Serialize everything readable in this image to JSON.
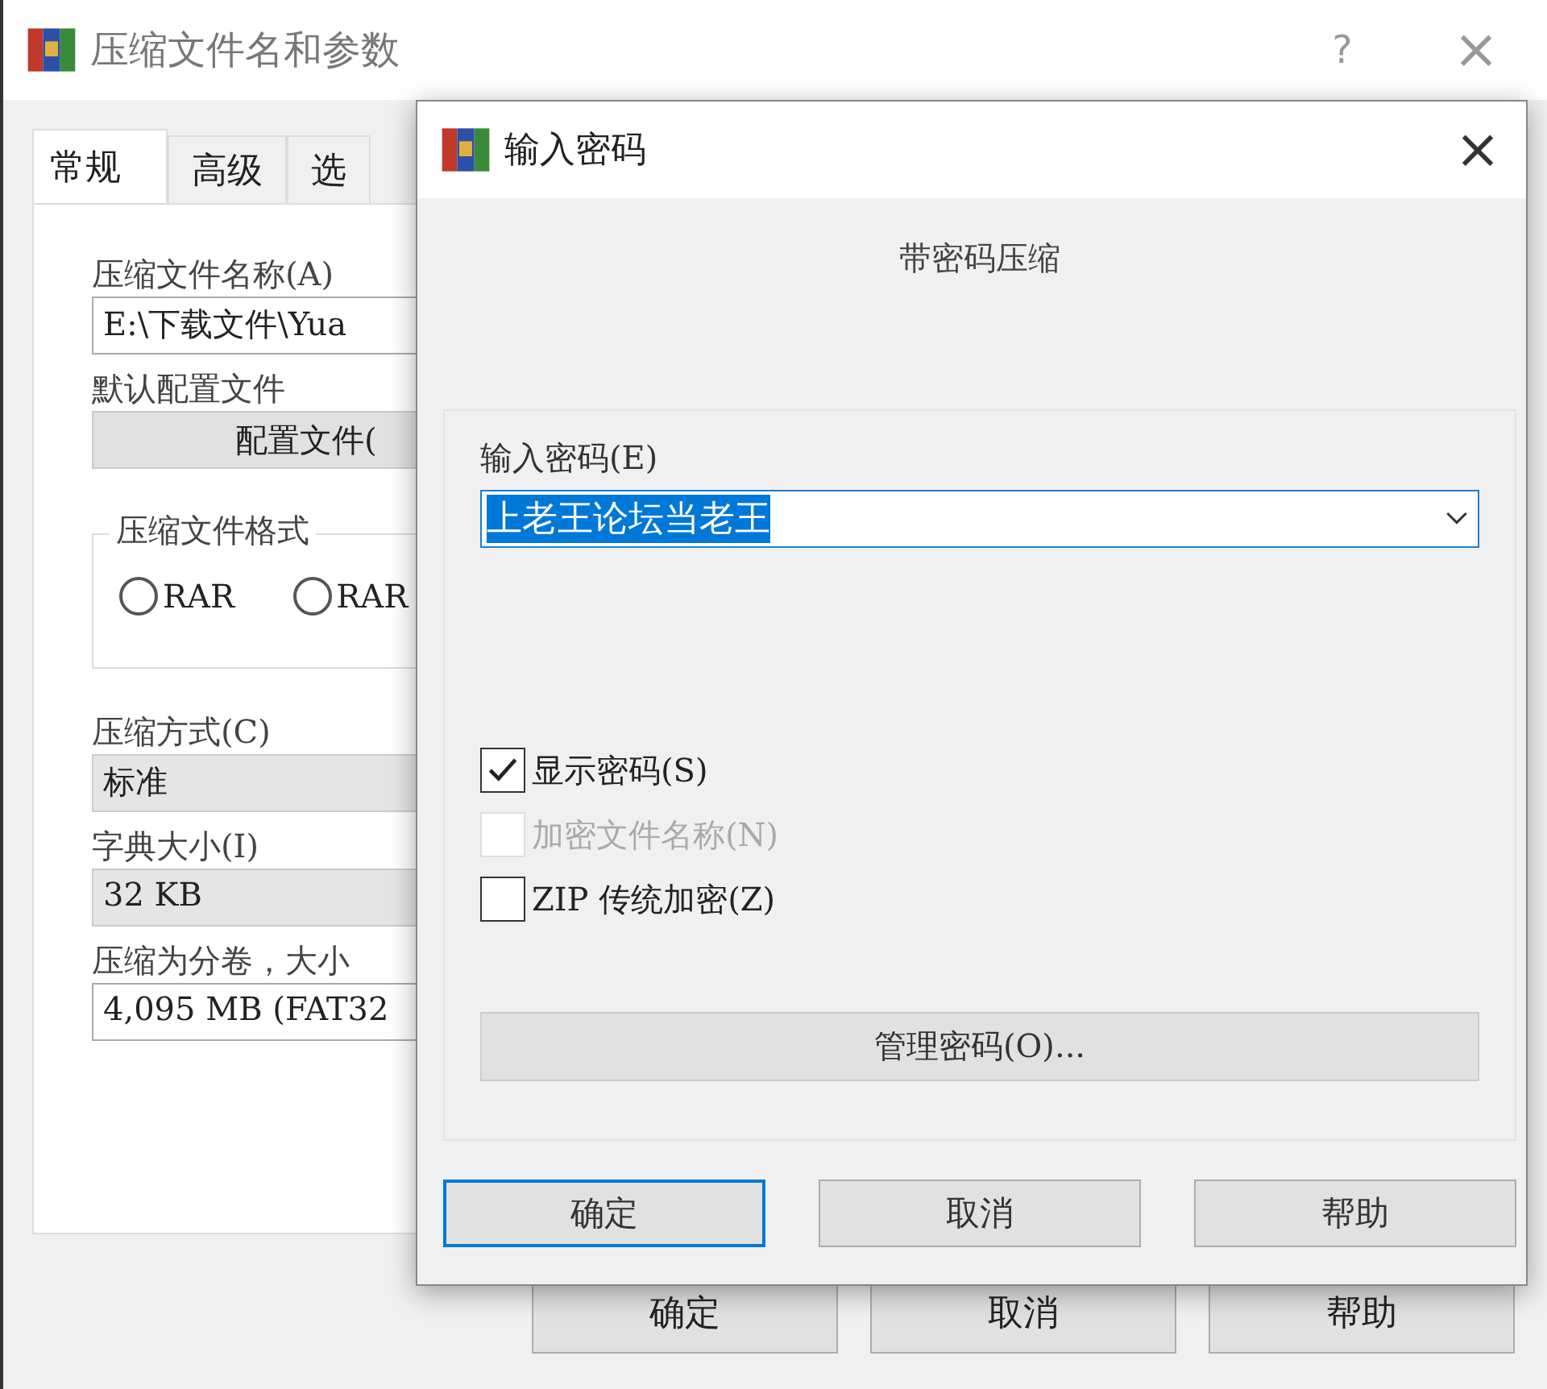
{
  "main_window": {
    "title": "压缩文件名和参数",
    "help": "?",
    "close": "×",
    "tabs": [
      {
        "label": "常规",
        "selected": true
      },
      {
        "label": "高级",
        "selected": false
      },
      {
        "label": "选",
        "selected": false
      }
    ],
    "archive_name": {
      "label": "压缩文件名称(A)",
      "value": "E:\\下载文件\\Yua"
    },
    "profile": {
      "label": "默认配置文件",
      "button": "配置文件("
    },
    "format": {
      "legend": "压缩文件格式",
      "options": [
        {
          "label": "RAR",
          "selected": false
        },
        {
          "label": "RAR",
          "selected": false
        }
      ]
    },
    "method": {
      "label": "压缩方式(C)",
      "value": "标准"
    },
    "dictionary": {
      "label": "字典大小(I)",
      "value": "32 KB"
    },
    "volumes": {
      "label": "压缩为分卷，大小",
      "value": "4,095 MB  (FAT32"
    },
    "buttons": [
      "确定",
      "取消",
      "帮助"
    ]
  },
  "password_dialog": {
    "title": "输入密码",
    "close": "×",
    "heading": "带密码压缩",
    "password": {
      "label": "输入密码(E)",
      "value": "上老王论坛当老王",
      "selected": true
    },
    "options": [
      {
        "label": "显示密码(S)",
        "checked": true,
        "disabled": false
      },
      {
        "label": "加密文件名称(N)",
        "checked": false,
        "disabled": true
      },
      {
        "label": "ZIP 传统加密(Z)",
        "checked": false,
        "disabled": false
      }
    ],
    "manage_button": "管理密码(O)...",
    "buttons": [
      {
        "label": "确定",
        "default": true
      },
      {
        "label": "取消",
        "default": false
      },
      {
        "label": "帮助",
        "default": false
      }
    ]
  }
}
